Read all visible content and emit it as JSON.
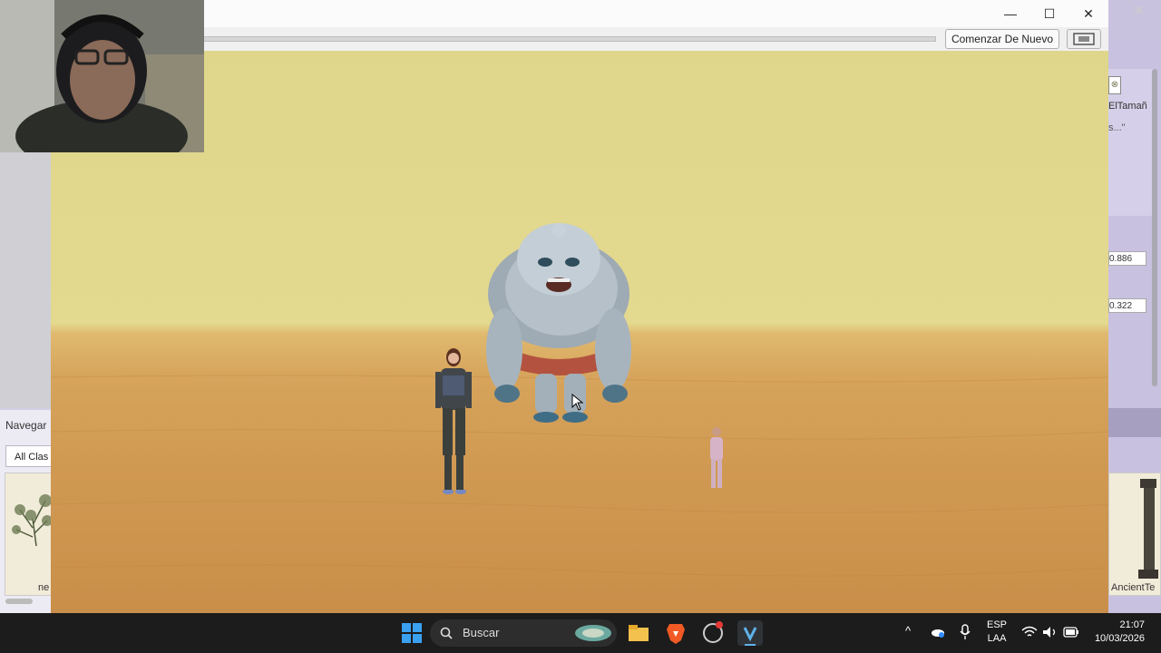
{
  "window": {
    "restart_button": "Comenzar De Nuevo",
    "minimize": "—",
    "maximize": "☐",
    "close": "✕"
  },
  "left_panel": {
    "navigator_title": "Navegar",
    "class_button": "All Clas",
    "gallery_item_label": "ne"
  },
  "right_panel": {
    "label_size": "ElTamañ",
    "label_dots": "s...\"",
    "field_1": "0.886",
    "field_2": "0.322",
    "gallery_item_label": "AncientTe"
  },
  "taskbar": {
    "search_placeholder": "Buscar",
    "lang_top": "ESP",
    "lang_bottom": "LAA",
    "time": "21:07",
    "date": "10/03/2026"
  },
  "colors": {
    "sky": "#dfd68c",
    "sand": "#d09952",
    "taskbar": "#1c1c1c"
  }
}
